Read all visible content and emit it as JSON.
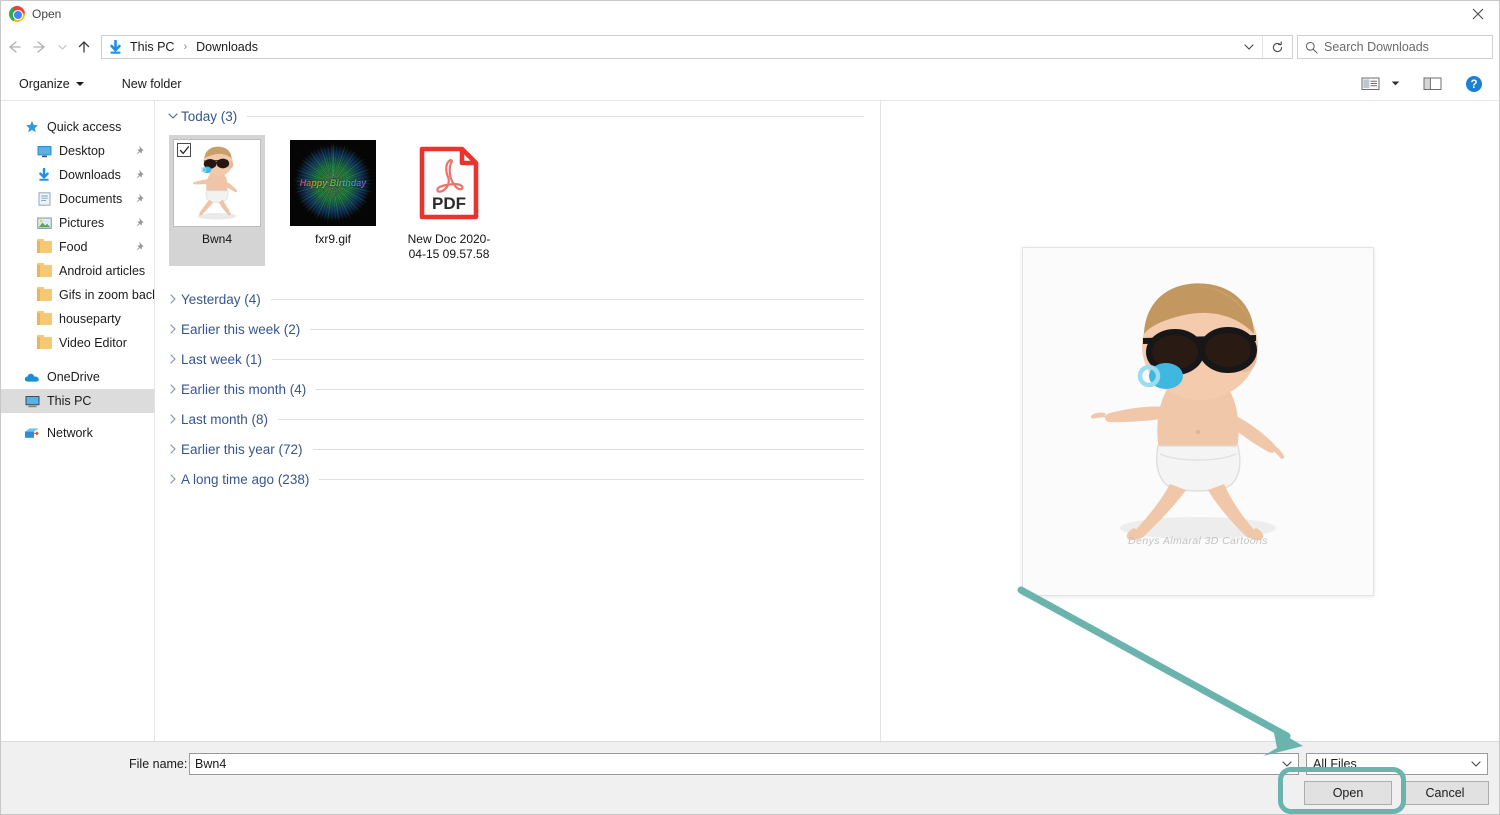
{
  "window": {
    "title": "Open",
    "app_icon": "chrome-logo-icon",
    "close_label": "close-icon"
  },
  "nav": {
    "back_icon": "back-arrow-icon",
    "forward_icon": "forward-arrow-icon",
    "recent_icon": "recent-locations-icon",
    "up_icon": "up-arrow-icon",
    "address_icon": "downloads-arrow-icon",
    "breadcrumbs": [
      "This PC",
      "Downloads"
    ],
    "dropdown_icon": "chevron-down-icon",
    "refresh_icon": "refresh-icon"
  },
  "search": {
    "placeholder": "Search Downloads",
    "icon": "search-icon"
  },
  "toolbar": {
    "organize_label": "Organize",
    "new_folder_label": "New folder",
    "view_icon": "change-view-icon",
    "view_dropdown_icon": "chevron-down-icon",
    "preview_pane_icon": "preview-pane-icon",
    "help_icon": "help-icon"
  },
  "sidebar": {
    "items": [
      {
        "label": "Quick access",
        "icon": "star-icon",
        "indent": false,
        "pinned": false,
        "selected": false
      },
      {
        "label": "Desktop",
        "icon": "desktop-icon",
        "indent": true,
        "pinned": true,
        "selected": false
      },
      {
        "label": "Downloads",
        "icon": "downloads-icon",
        "indent": true,
        "pinned": true,
        "selected": false
      },
      {
        "label": "Documents",
        "icon": "documents-icon",
        "indent": true,
        "pinned": true,
        "selected": false
      },
      {
        "label": "Pictures",
        "icon": "pictures-icon",
        "indent": true,
        "pinned": true,
        "selected": false
      },
      {
        "label": "Food",
        "icon": "folder-icon",
        "indent": true,
        "pinned": true,
        "selected": false
      },
      {
        "label": "Android articles",
        "icon": "folder-icon",
        "indent": true,
        "pinned": false,
        "selected": false
      },
      {
        "label": "Gifs in zoom backgr",
        "icon": "folder-icon",
        "indent": true,
        "pinned": false,
        "selected": false
      },
      {
        "label": "houseparty",
        "icon": "folder-icon",
        "indent": true,
        "pinned": false,
        "selected": false
      },
      {
        "label": "Video Editor",
        "icon": "folder-icon",
        "indent": true,
        "pinned": false,
        "selected": false
      }
    ],
    "roots": [
      {
        "label": "OneDrive",
        "icon": "onedrive-cloud-icon",
        "selected": false
      },
      {
        "label": "This PC",
        "icon": "this-pc-icon",
        "selected": true
      },
      {
        "label": "Network",
        "icon": "network-icon",
        "selected": false
      }
    ]
  },
  "filelist": {
    "groups": [
      {
        "label": "Today (3)",
        "expanded": true,
        "chevron": "chevron-down-icon"
      },
      {
        "label": "Yesterday (4)",
        "expanded": false,
        "chevron": "chevron-right-icon"
      },
      {
        "label": "Earlier this week (2)",
        "expanded": false,
        "chevron": "chevron-right-icon"
      },
      {
        "label": "Last week (1)",
        "expanded": false,
        "chevron": "chevron-right-icon"
      },
      {
        "label": "Earlier this month (4)",
        "expanded": false,
        "chevron": "chevron-right-icon"
      },
      {
        "label": "Last month (8)",
        "expanded": false,
        "chevron": "chevron-right-icon"
      },
      {
        "label": "Earlier this year (72)",
        "expanded": false,
        "chevron": "chevron-right-icon"
      },
      {
        "label": "A long time ago (238)",
        "expanded": false,
        "chevron": "chevron-right-icon"
      }
    ],
    "files": [
      {
        "name": "Bwn4",
        "kind": "baby-3d-image",
        "selected": true,
        "checked": true
      },
      {
        "name": "fxr9.gif",
        "kind": "gif-fireworks",
        "selected": false,
        "checked": false
      },
      {
        "name": "New Doc 2020-04-15 09.57.58",
        "kind": "pdf-document",
        "selected": false,
        "checked": false,
        "badge": "PDF"
      }
    ]
  },
  "preview": {
    "item": "Bwn4",
    "watermark": "Denys Almaral 3D Cartoons"
  },
  "bottom": {
    "filename_label": "File name:",
    "filename_value": "Bwn4",
    "filename_chevron_icon": "chevron-down-icon",
    "filter_value": "All Files",
    "filter_chevron_icon": "chevron-down-icon",
    "open_label": "Open",
    "cancel_label": "Cancel"
  },
  "annotations": {
    "highlight_color": "#6bb3ad",
    "arrow_target": "open-button",
    "ring_target": "open-button"
  }
}
